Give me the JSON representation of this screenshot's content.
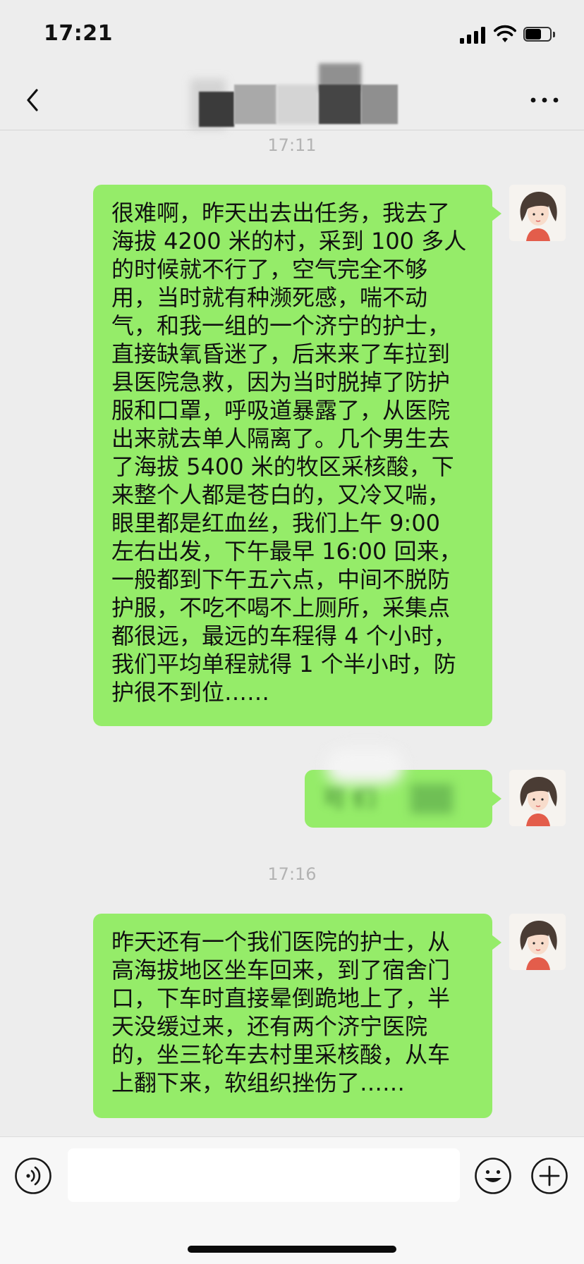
{
  "status_bar": {
    "time": "17:21",
    "battery_percent": 65
  },
  "nav": {
    "title": "",
    "back_icon": "chevron-left-icon",
    "more_icon": "more-dots-icon"
  },
  "messages": {
    "timestamp_1": "17:11",
    "timestamp_2": "17:16",
    "msg_1_lines": [
      "很难啊，昨天出去出任务，我去了",
      "海拔 4200 米的村，采到 100 多人",
      "的时候就不行了，空气完全不够",
      "用，当时就有种濒死感，喘不动",
      "气，和我一组的一个济宁的护士，",
      "直接缺氧昏迷了，后来来了车拉到",
      "县医院急救，因为当时脱掉了防护",
      "服和口罩，呼吸道暴露了，从医院",
      "出来就去单人隔离了。几个男生去",
      "了海拔 5400 米的牧区采核酸，下",
      "来整个人都是苍白的，又冷又喘，",
      "眼里都是红血丝，我们上午 9:00",
      "左右出发，下午最早 16:00 回来，",
      "一般都到下午五六点，中间不脱防",
      "护服，不吃不喝不上厕所，采集点",
      "都很远，最远的车程得 4 个小时，",
      "我们平均单程就得 1 个半小时，防",
      "护很不到位……"
    ],
    "msg_2_text": "可 们",
    "msg_3_lines": [
      "昨天还有一个我们医院的护士，从",
      "高海拔地区坐车回来，到了宿舍门",
      "口，下车时直接晕倒跪地上了，半",
      "天没缓过来，还有两个济宁医院",
      "的，坐三轮车去村里采核酸，从车",
      "上翻下来，软组织挫伤了……"
    ]
  },
  "input_bar": {
    "input_value": "",
    "voice_icon": "voice-icon",
    "emoji_icon": "emoji-icon",
    "plus_icon": "plus-icon"
  },
  "colors": {
    "bubble": "#95ec69",
    "background": "#ededed",
    "input_bar": "#f7f7f7"
  }
}
